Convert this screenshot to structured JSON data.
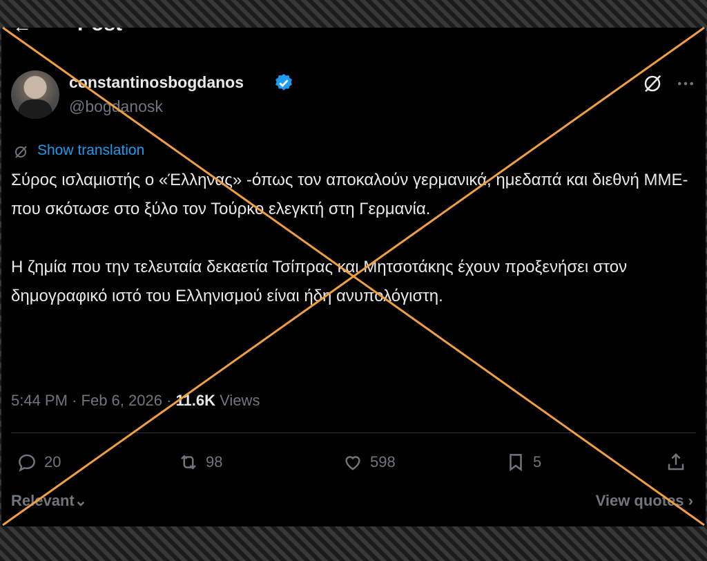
{
  "header": {
    "title": "Post",
    "back_icon": "arrow-left-icon"
  },
  "author": {
    "display_name": "constantinosbogdanos",
    "handle": "@bogdanosk",
    "verified": true
  },
  "icons": {
    "grok": "grok-icon",
    "more": "more-options-icon"
  },
  "translation": {
    "label": "Show translation"
  },
  "tweet": {
    "paragraph1": "Σύρος ισλαμιστής ο «Έλληνας» -όπως τον αποκαλούν γερμανικά, ημεδαπά και διεθνή ΜΜΕ- που σκότωσε στο ξύλο τον Τούρκο ελεγκτή στη Γερμανία.",
    "paragraph2": "Η ζημία που την τελευταία δεκαετία Τσίπρας και Μητσοτάκης έχουν προξενήσει στον δημογραφικό ιστό του Ελληνισμού είναι ήδη ανυπολόγιστη."
  },
  "meta": {
    "time": "5:44 PM",
    "separator": "·",
    "date": "Feb 6, 2026",
    "views_count": "11.6K",
    "views_label": "Views"
  },
  "actions": {
    "replies": "20",
    "reposts": "98",
    "likes": "598",
    "bookmarks": "5"
  },
  "footer": {
    "sort_label": "Relevant",
    "view_quotes": "View quotes"
  },
  "colors": {
    "accent": "#1d9bf0",
    "overlay_cross": "#f0a040",
    "background": "#000000",
    "text": "#e7e9ea",
    "muted": "#71767b"
  }
}
